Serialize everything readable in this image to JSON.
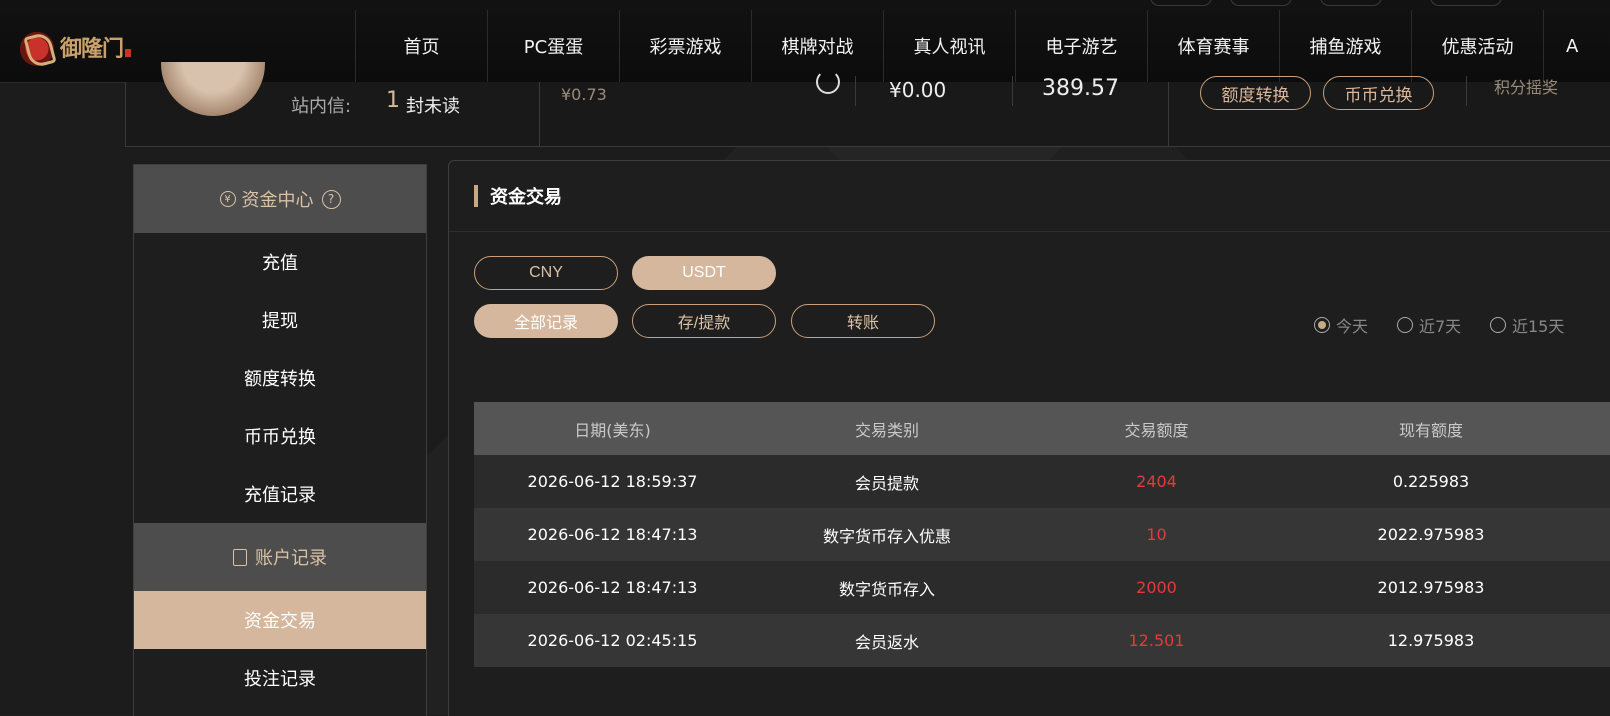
{
  "nav": {
    "logo_text": "御隆门",
    "items": [
      "首页",
      "PC蛋蛋",
      "彩票游戏",
      "棋牌对战",
      "真人视讯",
      "电子游艺",
      "体育赛事",
      "捕鱼游戏",
      "优惠活动",
      "A"
    ]
  },
  "user": {
    "message_label": "站内信:",
    "message_count": "1",
    "message_unread": "封未读",
    "balance_left": "¥0.73",
    "balance_mid": "¥0.00",
    "balance_right": "389.57",
    "transfer_button": "额度转换",
    "exchange_button": "币币兑换",
    "points_label": "积分摇奖"
  },
  "sidebar": {
    "section1": "资金中心",
    "section1_help": "?",
    "items1": [
      "充值",
      "提现",
      "额度转换",
      "币币兑换",
      "充值记录"
    ],
    "section2": "账户记录",
    "active": "资金交易",
    "items2": [
      "投注记录"
    ]
  },
  "panel": {
    "title": "资金交易",
    "currency_tabs": [
      "CNY",
      "USDT"
    ],
    "currency_active": "USDT",
    "filter_tabs": [
      "全部记录",
      "存/提款",
      "转账"
    ],
    "filter_active": "全部记录",
    "date_ranges": [
      "今天",
      "近7天",
      "近15天"
    ],
    "date_active": "今天"
  },
  "table": {
    "headers": [
      "日期(美东)",
      "交易类别",
      "交易额度",
      "现有额度"
    ],
    "rows": [
      [
        "2026-06-12 18:59:37",
        "会员提款",
        "2404",
        "0.225983"
      ],
      [
        "2026-06-12 18:47:13",
        "数字货币存入优惠",
        "10",
        "2022.975983"
      ],
      [
        "2026-06-12 18:47:13",
        "数字货币存入",
        "2000",
        "2012.975983"
      ],
      [
        "2026-06-12 02:45:15",
        "会员返水",
        "12.501",
        "12.975983"
      ]
    ]
  },
  "colors": {
    "accent": "#d4b79d",
    "amount_red": "#e23b3b"
  }
}
